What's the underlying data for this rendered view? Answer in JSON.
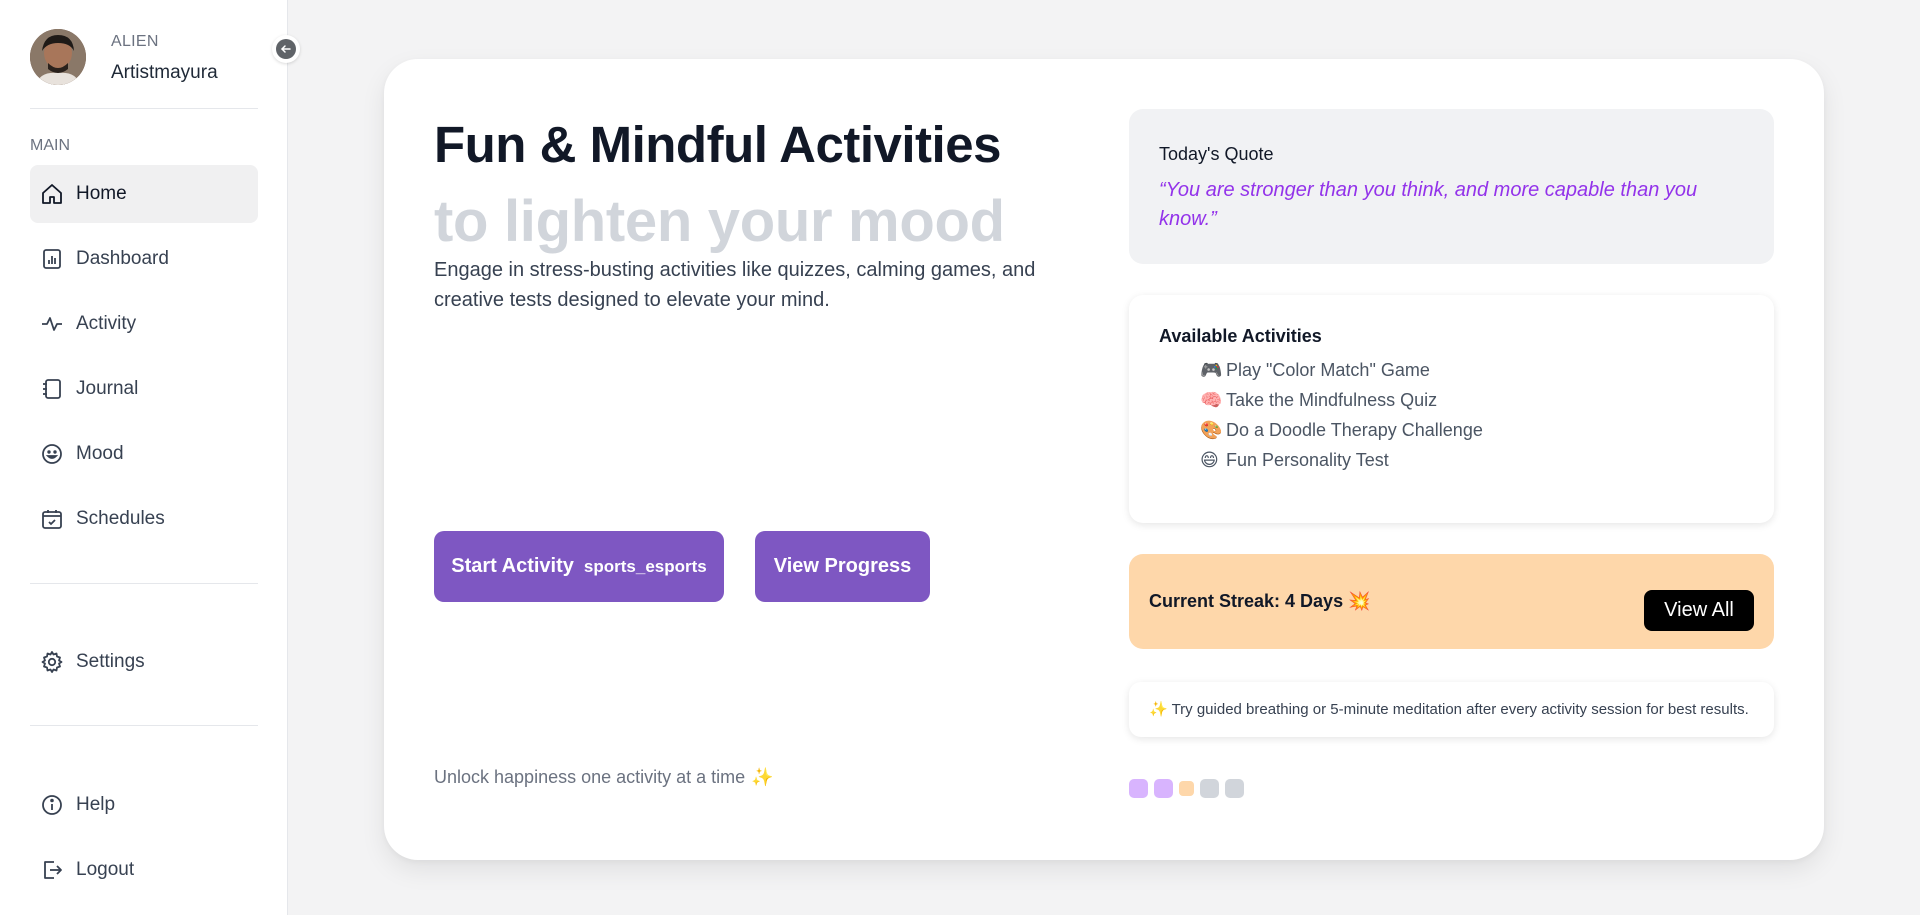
{
  "profile": {
    "role": "ALIEN",
    "name": "Artistmayura"
  },
  "sidebar": {
    "section_label": "MAIN",
    "items": [
      {
        "label": "Home",
        "icon": "home-icon",
        "active": true
      },
      {
        "label": "Dashboard",
        "icon": "bar-chart-icon"
      },
      {
        "label": "Activity",
        "icon": "activity-pulse-icon"
      },
      {
        "label": "Journal",
        "icon": "notebook-icon"
      },
      {
        "label": "Mood",
        "icon": "smiley-icon"
      },
      {
        "label": "Schedules",
        "icon": "calendar-check-icon"
      }
    ],
    "settings_label": "Settings",
    "help_label": "Help",
    "logout_label": "Logout"
  },
  "hero": {
    "title": "Fun & Mindful Activities",
    "subtitle": "to lighten your mood",
    "description": "Engage in stress-busting activities like quizzes, calming games, and creative tests designed to elevate your mind.",
    "start_button": "Start Activity",
    "start_button_icon": "sports_esports",
    "progress_button": "View Progress",
    "tagline": "Unlock happiness one activity at a time",
    "tagline_emoji": "✨"
  },
  "quote": {
    "title": "Today's Quote",
    "text": "“You are stronger than you think, and more capable than you know.”"
  },
  "activities": {
    "title": "Available Activities",
    "items": [
      {
        "emoji": "🎮",
        "label": "Play \"Color Match\" Game"
      },
      {
        "emoji": "🧠",
        "label": "Take the Mindfulness Quiz"
      },
      {
        "emoji": "🎨",
        "label": "Do a Doodle Therapy Challenge"
      },
      {
        "emoji": "😄",
        "label": "Fun Personality Test"
      }
    ]
  },
  "streak": {
    "text": "Current Streak: 4 Days 💥",
    "button": "View All"
  },
  "tip": {
    "text": "✨ Try guided breathing or 5-minute meditation after every activity session for best results."
  },
  "colors": {
    "accent": "#7e57c2",
    "quote_text": "#9333ea",
    "streak_bg": "#fed7aa",
    "dots": [
      "#d8b4fe",
      "#d8b4fe",
      "#fed7aa",
      "#d1d5db",
      "#d1d5db"
    ]
  }
}
